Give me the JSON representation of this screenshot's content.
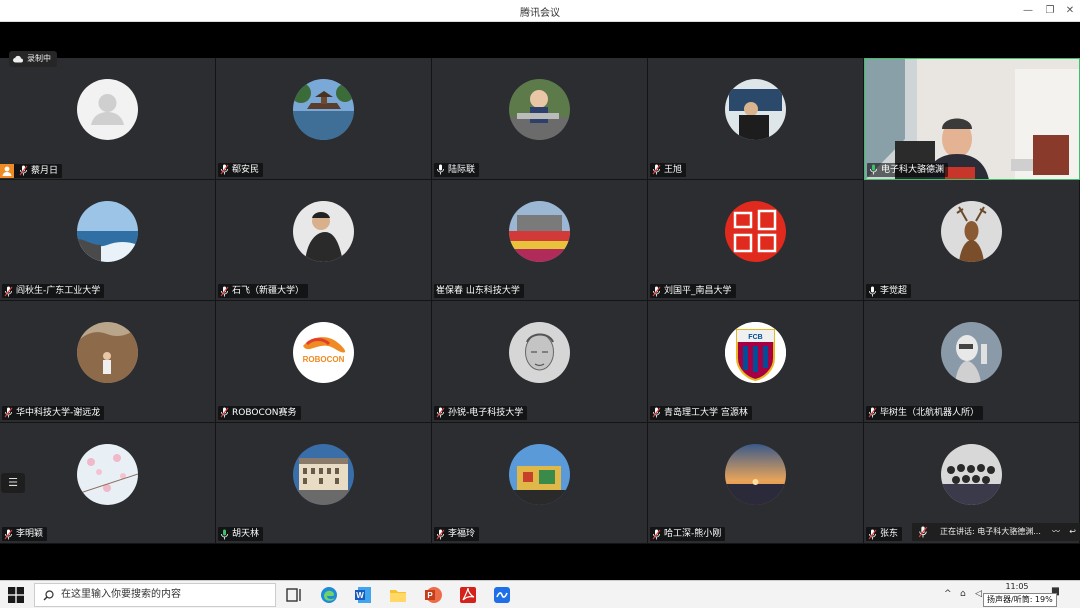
{
  "window": {
    "title": "腾讯会议"
  },
  "recording": {
    "label": "录制中"
  },
  "participants": [
    {
      "name": "蔡月日",
      "mic": "muted",
      "host": true
    },
    {
      "name": "郗安民",
      "mic": "muted"
    },
    {
      "name": "陆际联",
      "mic": "on"
    },
    {
      "name": "王旭",
      "mic": "muted"
    },
    {
      "name": "电子科大骆德渊",
      "mic": "active",
      "video": true
    },
    {
      "name": "阎秋生-广东工业大学",
      "mic": "muted"
    },
    {
      "name": "石飞（新疆大学）",
      "mic": "muted"
    },
    {
      "name": "崔保春 山东科技大学",
      "mic": "none"
    },
    {
      "name": "刘国平_南昌大学",
      "mic": "muted"
    },
    {
      "name": "李觉超",
      "mic": "on"
    },
    {
      "name": "华中科技大学-谢远龙",
      "mic": "muted"
    },
    {
      "name": "ROBOCON赛务",
      "mic": "muted"
    },
    {
      "name": "孙锐-电子科技大学",
      "mic": "muted"
    },
    {
      "name": "青岛理工大学 宫源林",
      "mic": "muted"
    },
    {
      "name": "毕树生（北航机器人所）",
      "mic": "muted"
    },
    {
      "name": "李明颖",
      "mic": "muted"
    },
    {
      "name": "胡天林",
      "mic": "on"
    },
    {
      "name": "李福玲",
      "mic": "muted"
    },
    {
      "name": "哈工深-熊小刚",
      "mic": "muted"
    },
    {
      "name": "张东",
      "mic": "muted"
    }
  ],
  "avatar_texts": {
    "robocon": "ROBOCON",
    "fcb": "FCB"
  },
  "speaking": {
    "label": "正在讲话: 电子科大骆德渊..."
  },
  "taskbar": {
    "search_placeholder": "在这里输入你要搜索的内容",
    "time": "11:05",
    "tooltip": "扬声器/听筒: 19%"
  },
  "colors": {
    "tile_bg": "#2b2d31",
    "active_border": "#3fbf6a",
    "host_badge": "#f08a24"
  }
}
